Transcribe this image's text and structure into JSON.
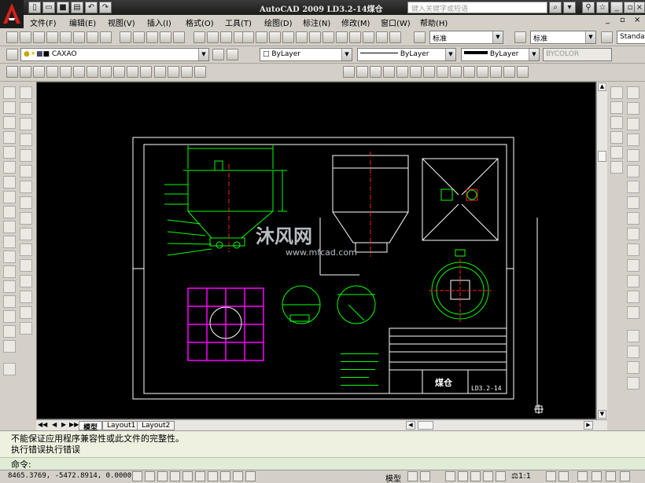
{
  "title_bar": {
    "title": "AutoCAD 2009  LD3.2-14煤仓",
    "search_placeholder": "键入关键字或短语"
  },
  "menu": {
    "items": [
      "文件(F)",
      "编辑(E)",
      "视图(V)",
      "插入(I)",
      "格式(O)",
      "工具(T)",
      "绘图(D)",
      "标注(N)",
      "修改(M)",
      "窗口(W)",
      "帮助(H)"
    ]
  },
  "toolbar_standard": {
    "text_style": "标准",
    "dim_style": "标准",
    "table_style": "Standar"
  },
  "toolbar_layers": {
    "layer_name": "CAXAO",
    "color": "ByLayer",
    "linetype": "ByLayer",
    "lineweight": "ByLayer",
    "plot_style": "BYCOLOR"
  },
  "layout_tabs": [
    "模型",
    "Layout1",
    "Layout2"
  ],
  "active_tab": "模型",
  "command": {
    "lines": [
      "不能保证应用程序兼容性或此文件的完整性。",
      "执行错误执行错误"
    ],
    "prompt": "命令:"
  },
  "status": {
    "coordinates": "8465.3769, -5472.8914, 0.0000",
    "space": "模型",
    "scale": "1:1"
  },
  "drawing": {
    "title_block_name": "煤仓",
    "drawing_number": "LD3.2-14",
    "colors": {
      "background": "#000000",
      "green": "#00ff00",
      "magenta": "#ff00ff",
      "red": "#ff2020",
      "white": "#ffffff",
      "cyan": "#00ffff"
    }
  },
  "watermark": {
    "brand": "沐风网",
    "url": "www.mfcad.com"
  }
}
